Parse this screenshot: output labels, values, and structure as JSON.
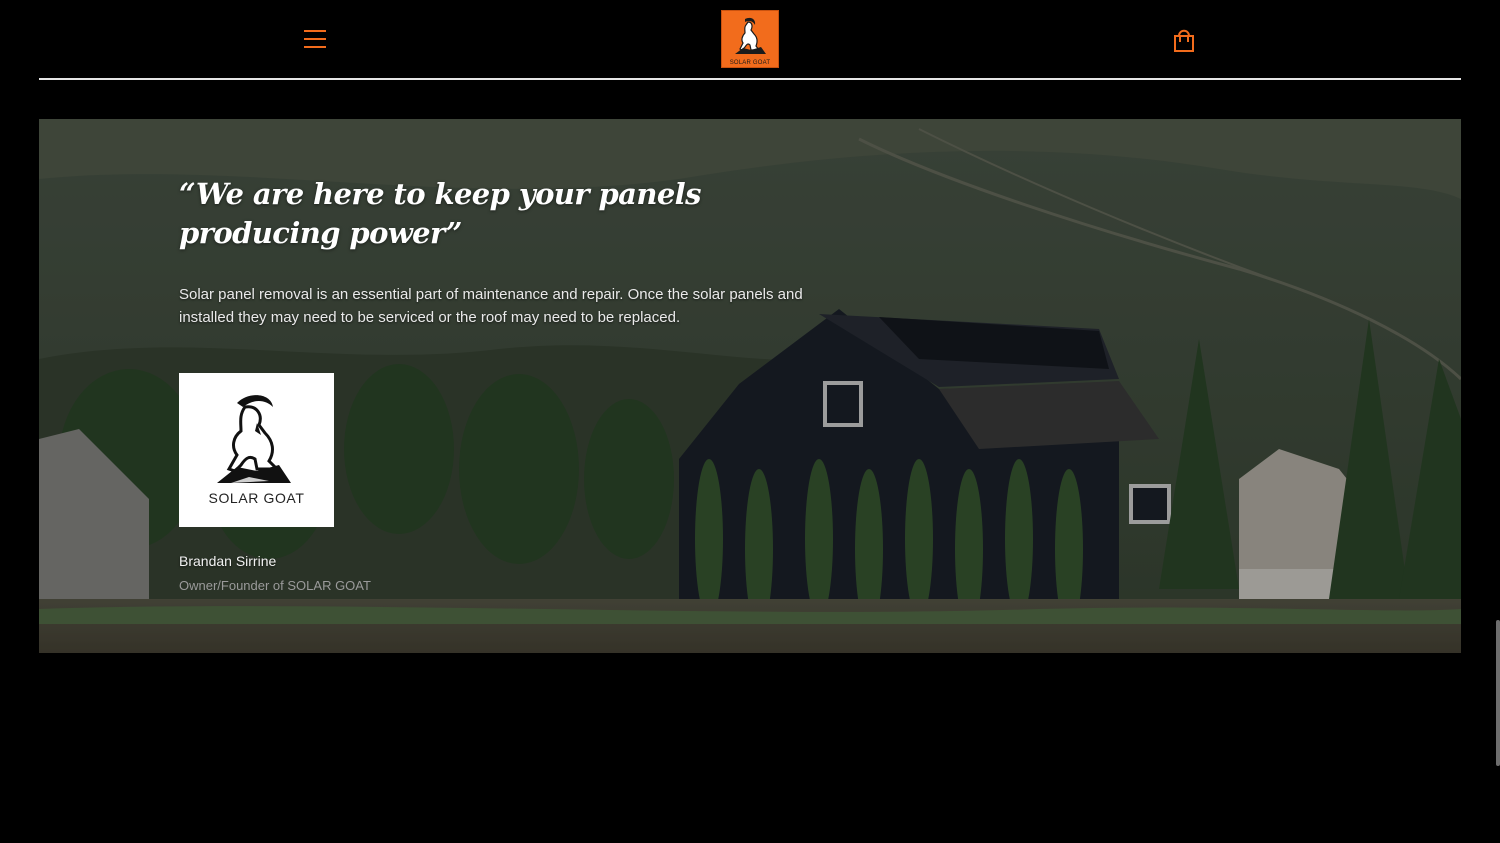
{
  "header": {
    "menu_icon": "hamburger-menu-icon",
    "logo_text": "SOLAR GOAT",
    "cart_icon": "shopping-bag-icon",
    "accent_color": "#f26c1c"
  },
  "hero": {
    "quote": "“We are here to keep your panels producing power”",
    "description": "Solar panel removal is an essential part of maintenance and repair. Once the solar panels and installed they may need to be serviced or the roof may need to be replaced.",
    "owner_logo_text": "SOLAR GOAT",
    "owner_name": "Brandan Sirrine",
    "owner_role": "Owner/Founder of SOLAR GOAT"
  }
}
